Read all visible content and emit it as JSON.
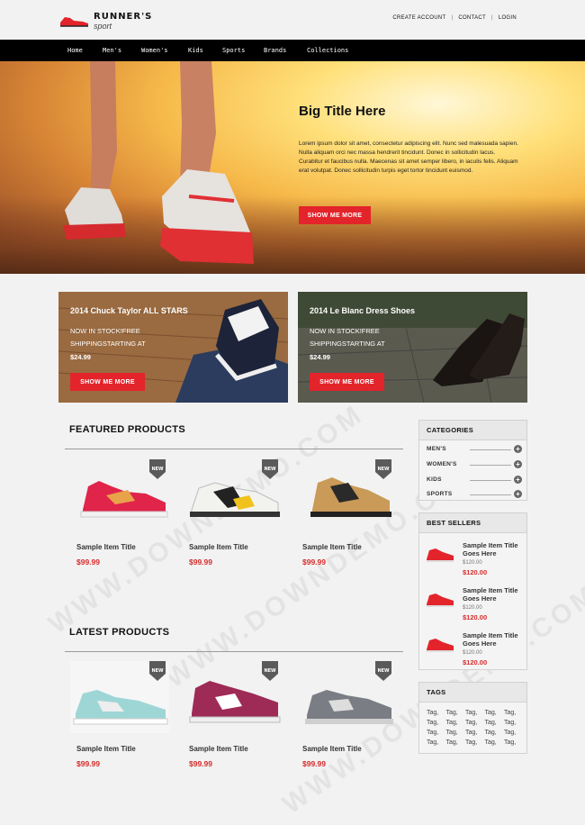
{
  "brand": {
    "name": "RUNNER'S",
    "sub": "sport"
  },
  "toplinks": [
    "CREATE ACCOUNT",
    "CONTACT",
    "LOGIN"
  ],
  "nav": [
    "Home",
    "Men's",
    "Women's",
    "Kids",
    "Sports",
    "Brands",
    "Collections"
  ],
  "hero": {
    "title": "Big Title Here",
    "body": "Lorem ipsum dolor sit amet, consectetur adipiscing elit. Nunc sed malesuada sapien. Nulla aliquam orci nec massa hendrerit tincidunt. Donec in sollicitudin lacus. Curabitur et faucibus nulla. Maecenas sit amet semper libero, in iaculis felis. Aliquam erat volutpat. Donec sollicitudin turpis eget tortor tincidunt euismod.",
    "button": "SHOW ME MORE"
  },
  "promos": [
    {
      "title": "2014 Chuck Taylor ALL STARS",
      "line1": "NOW IN STOCK!FREE",
      "line2": "SHIPPINGSTARTING AT",
      "price": "$24.99",
      "button": "SHOW ME MORE"
    },
    {
      "title": "2014 Le Blanc Dress Shoes",
      "line1": "NOW IN STOCK!FREE",
      "line2": "SHIPPINGSTARTING AT",
      "price": "$24.99",
      "button": "SHOW ME MORE"
    }
  ],
  "featured": {
    "heading": "FEATURED PRODUCTS",
    "items": [
      {
        "title": "Sample Item Title",
        "price": "$99.99",
        "badge": "NEW"
      },
      {
        "title": "Sample Item Title",
        "price": "$99.99",
        "badge": "NEW"
      },
      {
        "title": "Sample Item Title",
        "price": "$99.99",
        "badge": "NEW"
      }
    ]
  },
  "latest": {
    "heading": "LATEST PRODUCTS",
    "items": [
      {
        "title": "Sample Item Title",
        "price": "$99.99",
        "badge": "NEW"
      },
      {
        "title": "Sample Item Title",
        "price": "$99.99",
        "badge": "NEW"
      },
      {
        "title": "Sample Item Title",
        "price": "$99.99",
        "badge": "NEW"
      }
    ]
  },
  "categories": {
    "heading": "CATEGORIES",
    "items": [
      "MEN'S",
      "WOMEN'S",
      "KIDS",
      "SPORTS"
    ]
  },
  "bestsellers": {
    "heading": "BEST SELLERS",
    "items": [
      {
        "title": "Sample Item Title Goes Here",
        "old": "$120.00",
        "price": "$120.00"
      },
      {
        "title": "Sample Item Title Goes Here",
        "old": "$120.00",
        "price": "$120.00"
      },
      {
        "title": "Sample Item Title Goes Here",
        "old": "$120.00",
        "price": "$120.00"
      }
    ]
  },
  "tags": {
    "heading": "TAGS",
    "rows": [
      [
        "Tag,",
        "Tag,",
        "Tag,",
        "Tag,",
        "Tag,"
      ],
      [
        "Tag,",
        "Tag,",
        "Tag,",
        "Tag,",
        "Tag,"
      ],
      [
        "Tag,",
        "Tag,",
        "Tag,",
        "Tag,",
        "Tag,"
      ],
      [
        "Tag,",
        "Tag,",
        "Tag,",
        "Tag,",
        "Tag,"
      ]
    ]
  },
  "colors": {
    "accent": "#e3242b",
    "price": "#d62b2b",
    "nav": "#000000"
  }
}
